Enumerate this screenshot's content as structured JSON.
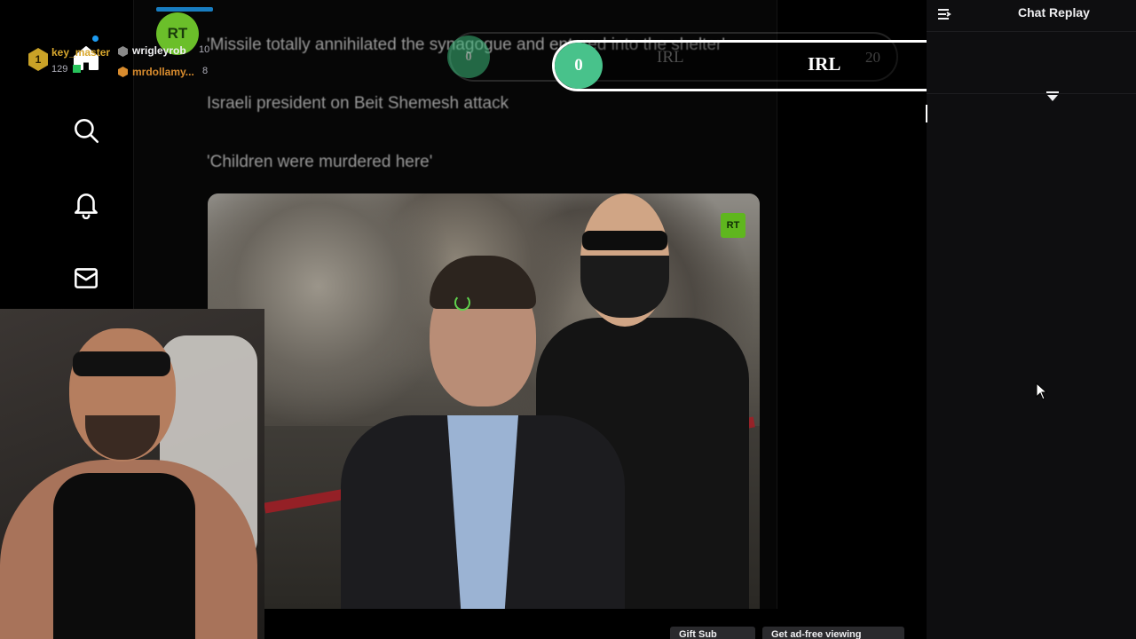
{
  "nav": {
    "items": [
      {
        "name": "home",
        "icon": "home-icon"
      },
      {
        "name": "search",
        "icon": "search-icon"
      },
      {
        "name": "notifications",
        "icon": "bell-icon"
      },
      {
        "name": "messages",
        "icon": "mail-icon"
      }
    ]
  },
  "tweet": {
    "avatar_text": "RT",
    "lines": [
      "'Missile totally annihilated the synagogue and entered into the shelter'",
      "Israeli president on Beit Shemesh attack",
      "'Children were murdered here'"
    ],
    "video_watermark": "RT"
  },
  "poll": {
    "option_count": "0",
    "option_label": "IRL",
    "total": "20",
    "ghost_count": "0",
    "ghost_label": "IRL",
    "ghost_total": "20"
  },
  "chat": {
    "title": "Chat Replay",
    "leaderboard": [
      {
        "rank": "1",
        "name": "key_master",
        "points": "129"
      },
      {
        "name": "wrigleyrob",
        "value": "10"
      },
      {
        "name": "mrdollamy...",
        "value": "8"
      }
    ]
  },
  "bottom": {
    "gift_button": "Gift Sub",
    "second_button": "Get ad-free viewing"
  },
  "colors": {
    "accent_green": "#48c28b",
    "rank_gold": "#c9a227",
    "twitter_blue": "#1d9bf0"
  }
}
